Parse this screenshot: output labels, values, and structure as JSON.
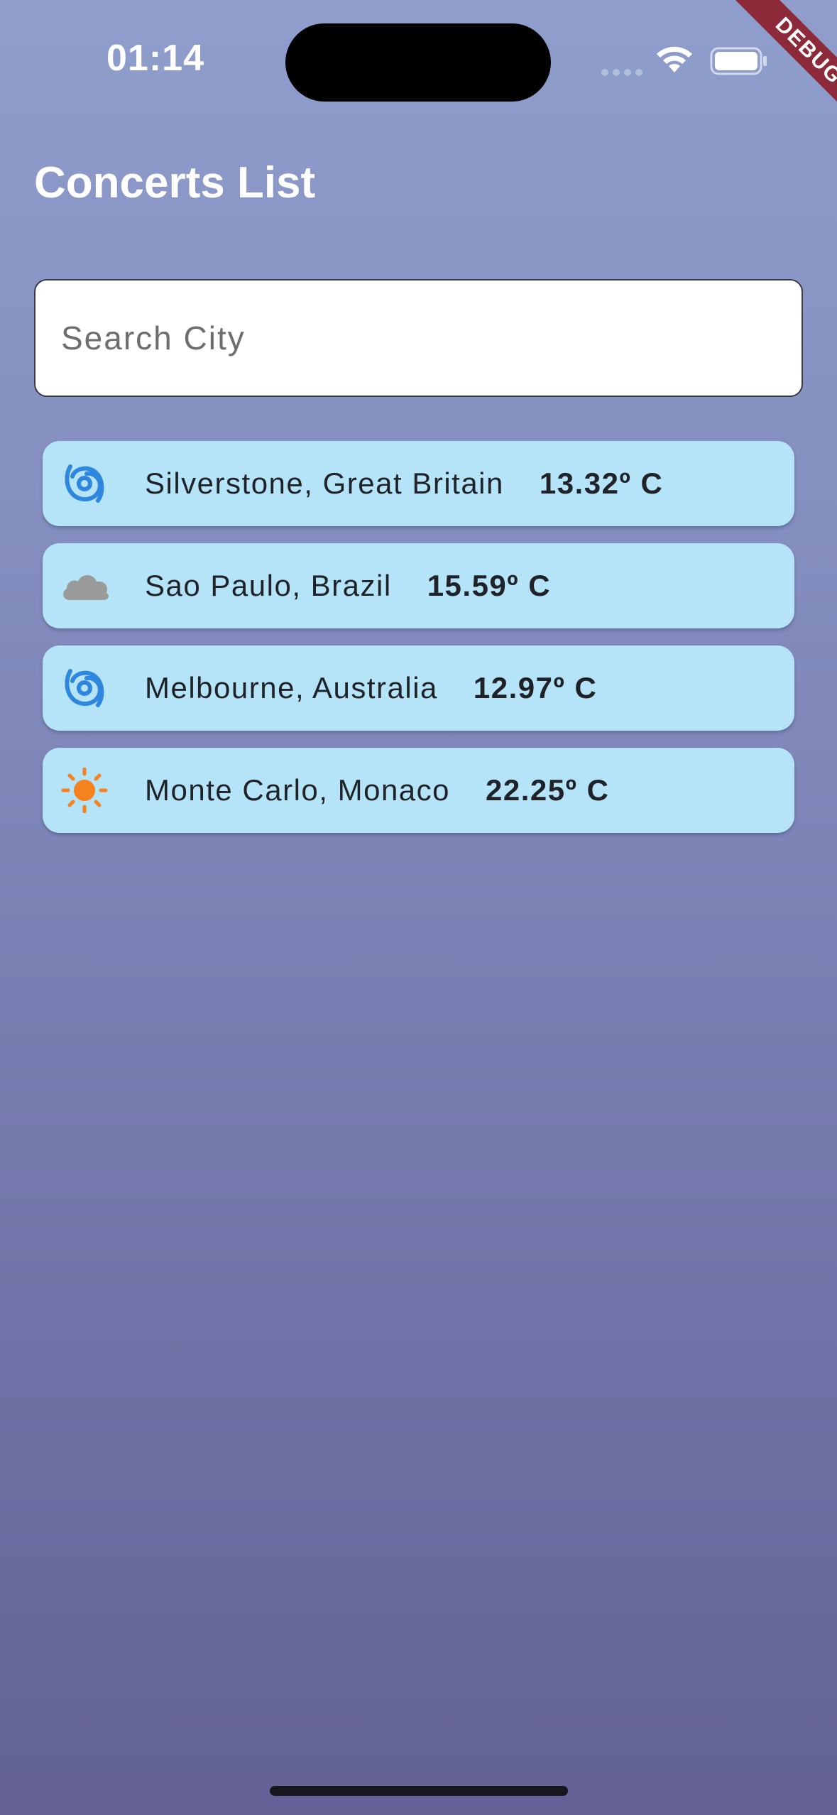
{
  "status_bar": {
    "time": "01:14"
  },
  "debug_banner": {
    "label": "DEBUG",
    "color": "#8d2a3a"
  },
  "header": {
    "title": "Concerts List"
  },
  "search": {
    "placeholder": "Search City",
    "value": ""
  },
  "concerts": [
    {
      "city": "Silverstone, Great Britain",
      "temperature": "13.32º C",
      "icon": "cyclone-icon"
    },
    {
      "city": "Sao Paulo, Brazil",
      "temperature": "15.59º C",
      "icon": "cloud-icon"
    },
    {
      "city": "Melbourne, Australia",
      "temperature": "12.97º C",
      "icon": "cyclone-icon"
    },
    {
      "city": "Monte Carlo, Monaco",
      "temperature": "22.25º C",
      "icon": "sun-icon"
    }
  ],
  "colors": {
    "card_background": "#b5e3f8",
    "cyclone_icon": "#2e86de",
    "cloud_icon": "#9a9a9a",
    "sun_icon": "#f5821f"
  }
}
